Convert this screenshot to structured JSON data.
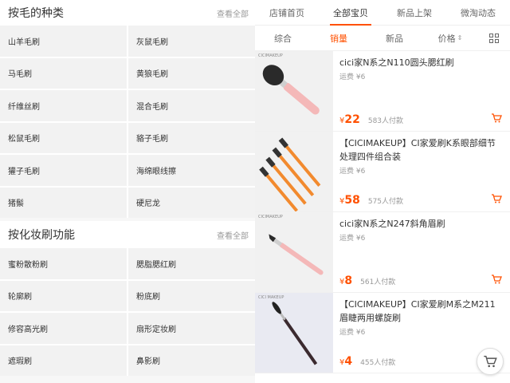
{
  "left": {
    "section1": {
      "title": "按毛的种类",
      "more": "查看全部",
      "items": [
        "山羊毛刷",
        "灰鼠毛刷",
        "马毛刷",
        "黄狼毛刷",
        "纤维丝刷",
        "混合毛刷",
        "松鼠毛刷",
        "貉子毛刷",
        "獾子毛刷",
        "海绵眼线擦",
        "猪鬃",
        "硬尼龙"
      ]
    },
    "section2": {
      "title": "按化妆刷功能",
      "more": "查看全部",
      "items": [
        "蜜粉散粉刷",
        "腮脂腮红刷",
        "轮廓刷",
        "粉底刷",
        "修容高光刷",
        "扇形定妆刷",
        "遮瑕刷",
        "鼻影刷"
      ]
    }
  },
  "right": {
    "tabs": [
      "店铺首页",
      "全部宝贝",
      "新品上架",
      "微淘动态"
    ],
    "sorts": {
      "composite": "综合",
      "sales": "销量",
      "newest": "新品",
      "price": "价格"
    },
    "products": [
      {
        "title": "cici家N系之N110圆头腮红刷",
        "ship": "运费 ¥6",
        "currency": "¥",
        "price": "22",
        "sold": "583人付款",
        "thumb_tag": "CICIMAKEUP"
      },
      {
        "title": "【CICIMAKEUP】CI家爱刷K系眼部细节处理四件组合装",
        "ship": "运费 ¥6",
        "currency": "¥",
        "price": "58",
        "sold": "575人付款",
        "thumb_tag": ""
      },
      {
        "title": "cici家N系之N247斜角眉刷",
        "ship": "运费 ¥6",
        "currency": "¥",
        "price": "8",
        "sold": "561人付款",
        "thumb_tag": "CICIMAKEUP"
      },
      {
        "title": "【CICIMAKEUP】CI家爱刷M系之M211眉睫两用螺旋刷",
        "ship": "运费 ¥6",
        "currency": "¥",
        "price": "4",
        "sold": "455人付款",
        "thumb_tag": "CICI MAKEUP"
      }
    ]
  },
  "colors": {
    "accent": "#ff5000",
    "muted": "#999999",
    "cell_bg": "#f2f2f2"
  }
}
